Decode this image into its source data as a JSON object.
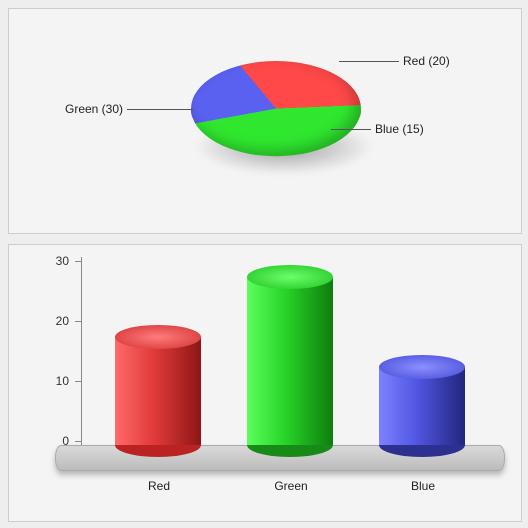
{
  "chart_data": [
    {
      "type": "pie",
      "labels": [
        "Red",
        "Green",
        "Blue"
      ],
      "values": [
        20,
        30,
        15
      ],
      "colors": [
        "#e13a3a",
        "#27d327",
        "#4f55e0"
      ],
      "slice_labels": [
        "Red (20)",
        "Green (30)",
        "Blue (15)"
      ]
    },
    {
      "type": "bar",
      "categories": [
        "Red",
        "Green",
        "Blue"
      ],
      "values": [
        20,
        30,
        15
      ],
      "colors": [
        "#e13a3a",
        "#27d327",
        "#4f55e0"
      ],
      "ylim": [
        0,
        30
      ],
      "yticks": [
        0,
        10,
        20,
        30
      ]
    }
  ]
}
